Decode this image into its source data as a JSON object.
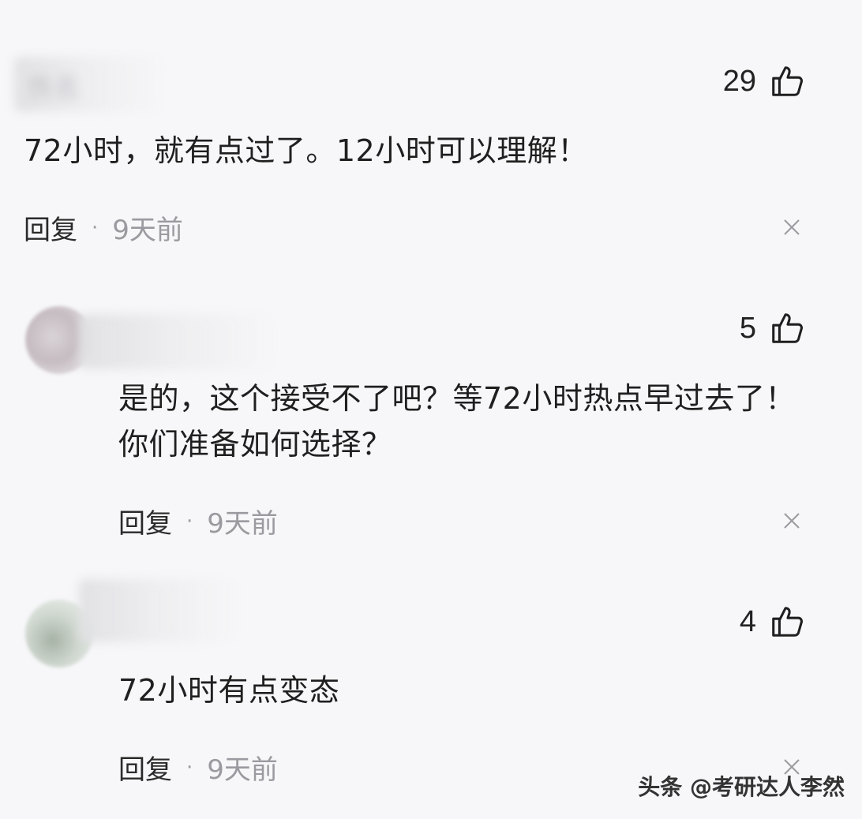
{
  "comments": [
    {
      "username": "佚名",
      "likes": "29",
      "text": "72小时，就有点过了。12小时可以理解！",
      "reply_label": "回复",
      "separator": "·",
      "time": "9天前"
    },
    {
      "username": "",
      "likes": "5",
      "text": "是的，这个接受不了吧？等72小时热点早过去了！你们准备如何选择？",
      "reply_label": "回复",
      "separator": "·",
      "time": "9天前"
    },
    {
      "username": "",
      "likes": "4",
      "text": "72小时有点变态",
      "reply_label": "回复",
      "separator": "·",
      "time": "9天前"
    }
  ],
  "watermark": "头条 @考研达人李然",
  "icons": {
    "like": "thumbs-up-icon",
    "dismiss": "close-icon"
  },
  "colors": {
    "background": "#f7f7f9",
    "text": "#1f1f1f",
    "muted": "#9a9aa0"
  }
}
